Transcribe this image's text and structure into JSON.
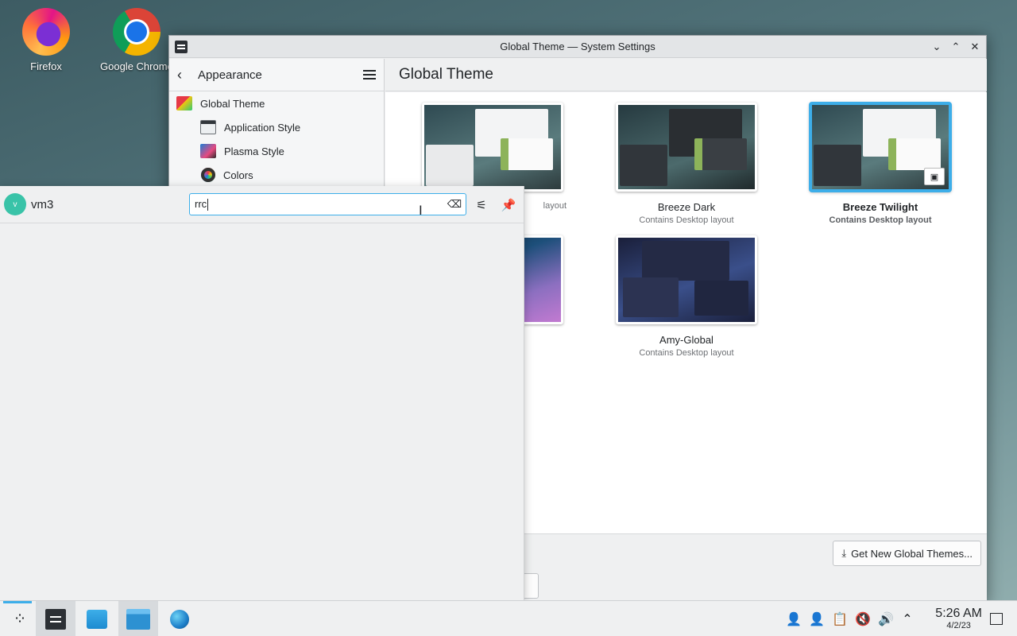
{
  "desktop": {
    "icons": [
      {
        "label": "Firefox"
      },
      {
        "label": "Google Chrome"
      }
    ]
  },
  "window": {
    "title": "Global Theme — System Settings",
    "controls": {
      "minimize": "⌄",
      "maximize": "⌃",
      "close": "✕"
    }
  },
  "sidebar": {
    "back_label": "Appearance",
    "items": [
      {
        "label": "Global Theme",
        "icon": "global-theme-icon"
      },
      {
        "label": "Application Style",
        "icon": "application-style-icon"
      },
      {
        "label": "Plasma Style",
        "icon": "plasma-style-icon"
      },
      {
        "label": "Colors",
        "icon": "colors-icon"
      }
    ]
  },
  "main": {
    "heading": "Global Theme",
    "themes": [
      {
        "name": "",
        "subtitle": "layout",
        "selected": false
      },
      {
        "name": "Breeze Dark",
        "subtitle": "Contains Desktop layout",
        "selected": false
      },
      {
        "name": "Breeze Twilight",
        "subtitle": "Contains Desktop layout",
        "selected": true
      },
      {
        "name": "",
        "subtitle": "",
        "selected": false
      },
      {
        "name": "Amy-Global",
        "subtitle": "Contains Desktop layout",
        "selected": false
      }
    ],
    "get_new_label": "Get New Global Themes..."
  },
  "krunner": {
    "user": "vm3",
    "avatar_letter": "v",
    "query": "rrc"
  },
  "taskbar": {
    "time": "5:26 AM",
    "date": "4/2/23"
  },
  "colors": {
    "accent": "#3daee9",
    "panel": "#eff0f1"
  }
}
